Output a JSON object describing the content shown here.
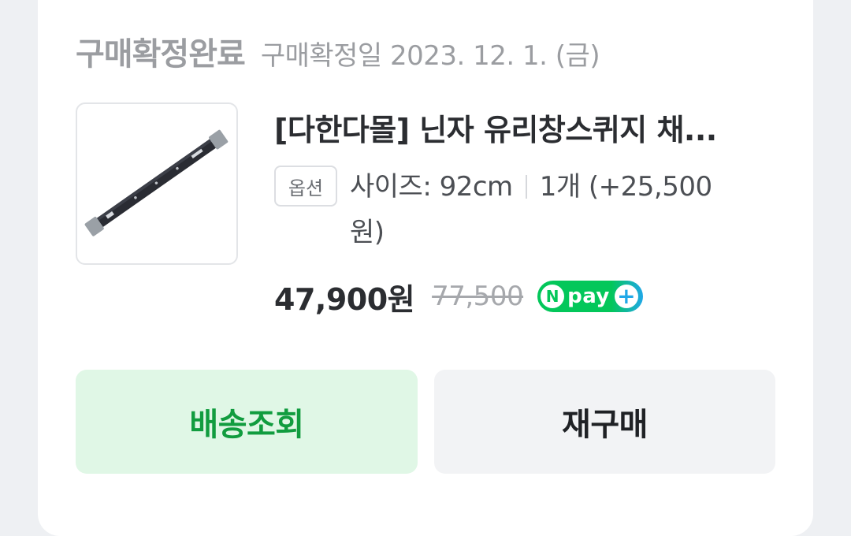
{
  "order": {
    "status_title": "구매확정완료",
    "status_date": "구매확정일 2023. 12. 1. (금)"
  },
  "product": {
    "thumbnail_icon": "window-squeegee-image",
    "name": "[다한다몰] 닌자 유리창스퀴지 채...",
    "option_badge": "옵션",
    "option_size": "사이즈: 92cm",
    "option_qty": "1개 (+25,500원)",
    "sale_price": "47,900원",
    "original_price": "77,500"
  },
  "npay": {
    "n": "N",
    "pay": "pay",
    "plus": "+"
  },
  "actions": {
    "track_label": "배송조회",
    "rebuy_label": "재구매"
  },
  "colors": {
    "accent_green": "#03c75a",
    "track_text": "#119c3f",
    "track_bg": "#e0f7e6"
  }
}
